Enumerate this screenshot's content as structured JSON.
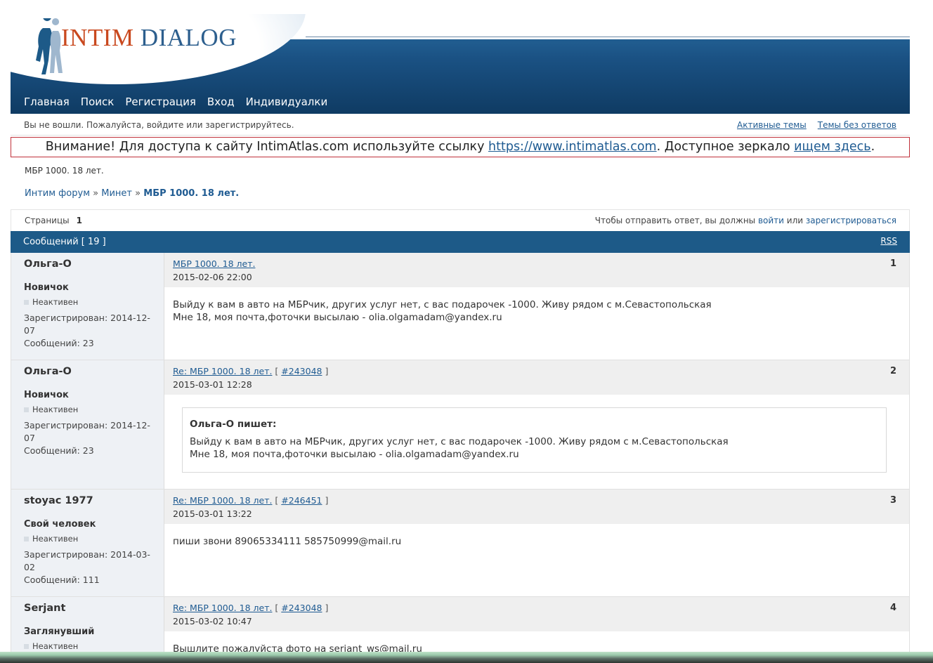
{
  "logo": {
    "word1": "INTIM",
    "word2": "DIALOG"
  },
  "nav": [
    "Главная",
    "Поиск",
    "Регистрация",
    "Вход",
    "Индивидуалки"
  ],
  "status": {
    "message": "Вы не вошли. Пожалуйста, войдите или зарегистрируйтесь.",
    "active_topics": "Активные темы",
    "unanswered": "Темы без ответов"
  },
  "announcement": {
    "prefix": "Внимание! Для доступа к сайту IntimAtlas.com используйте ссылку ",
    "link": "https://www.intimatlas.com",
    "middle": ". Доступное зеркало ",
    "mirror_link": "ищем здесь",
    "suffix": "."
  },
  "page_heading": "МБР 1000. 18 лет.",
  "breadcrumbs": {
    "forum": "Интим форум",
    "sep": "»",
    "section": "Минет",
    "current": "МБР 1000. 18 лет."
  },
  "pager": {
    "label": "Страницы",
    "page": "1",
    "reply_text": "Чтобы отправить ответ, вы должны ",
    "login": "войти",
    "or": " или ",
    "register": "зарегистрироваться"
  },
  "topic_bar": {
    "title": "Сообщений [ 19 ]",
    "rss": "RSS"
  },
  "posts": [
    {
      "author": "Ольга-О",
      "rank": "Новичок",
      "online": "Неактивен",
      "registered": "Зарегистрирован: 2014-12-07",
      "count": "Сообщений: 23",
      "title": "МБР 1000. 18 лет.",
      "ref": "",
      "date": "2015-02-06 22:00",
      "num": "1",
      "text1": "Выйду к вам в авто на МБРчик, других услуг нет, с вас подарочек -1000. Живу рядом с м.Севастопольская",
      "text2": "Мне 18, моя почта,фоточки высылаю - olia.olgamadam@yandex.ru"
    },
    {
      "author": "Ольга-О",
      "rank": "Новичок",
      "online": "Неактивен",
      "registered": "Зарегистрирован: 2014-12-07",
      "count": "Сообщений: 23",
      "title": "Re: МБР 1000. 18 лет.",
      "ref": "#243048",
      "date": "2015-03-01 12:28",
      "num": "2",
      "quote_head": "Ольга-О пишет:",
      "text1": "Выйду к вам в авто на МБРчик, других услуг нет, с вас подарочек -1000. Живу рядом с м.Севастопольская",
      "text2": "Мне 18, моя почта,фоточки высылаю - olia.olgamadam@yandex.ru"
    },
    {
      "author": "stoyac 1977",
      "rank": "Свой человек",
      "online": "Неактивен",
      "registered": "Зарегистрирован: 2014-03-02",
      "count": "Сообщений: 111",
      "title": "Re: МБР 1000. 18 лет.",
      "ref": "#246451",
      "date": "2015-03-01 13:22",
      "num": "3",
      "text1": "пиши звони 89065334111 585750999@mail.ru"
    },
    {
      "author": "Serjant",
      "rank": "Заглянувший",
      "online": "Неактивен",
      "title": "Re: МБР 1000. 18 лет.",
      "ref": "#243048",
      "date": "2015-03-02 10:47",
      "num": "4",
      "text1": "Вышлите пожалуйста фото на serjant_ws@mail.ru"
    }
  ]
}
